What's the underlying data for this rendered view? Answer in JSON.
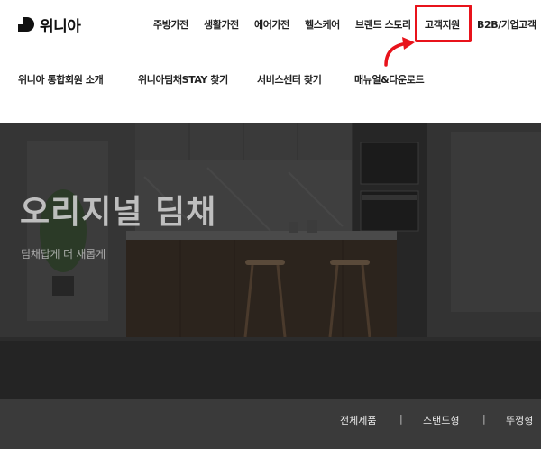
{
  "brand": {
    "name": "위니아"
  },
  "gnb": {
    "items": [
      "주방가전",
      "생활가전",
      "에어가전",
      "헬스케어",
      "브랜드 스토리",
      "고객지원",
      "B2B/기업고객"
    ],
    "highlighted": "고객지원",
    "highlight_color": "#e8131b"
  },
  "submenu": {
    "items": [
      "위니아 통합회원 소개",
      "위니아딤채STAY 찾기",
      "서비스센터 찾기",
      "매뉴얼&다운로드"
    ]
  },
  "hero": {
    "title": "오리지널 딤채",
    "subtitle": "딤채답게 더 새롭게"
  },
  "filter": {
    "items": [
      "전체제품",
      "스탠드형",
      "뚜껑형"
    ],
    "separator": "|"
  }
}
